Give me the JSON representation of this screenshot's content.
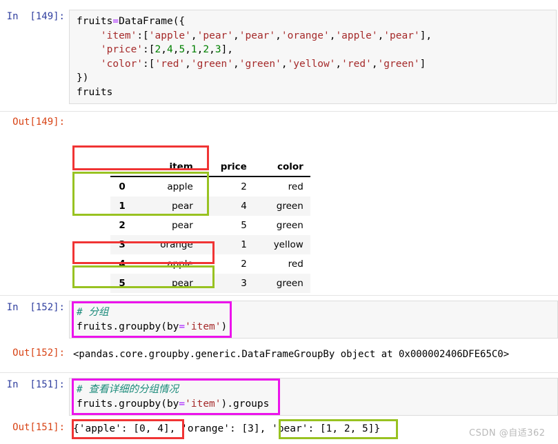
{
  "notebook": {
    "cells": [
      {
        "type": "code",
        "prompt": "In  [149]:",
        "lines": [
          "fruits=DataFrame({",
          "    'item':['apple','pear','pear','orange','apple','pear'],",
          "    'price':[2,4,5,1,2,3],",
          "    'color':['red','green','green','yellow','red','green']",
          "})",
          "fruits"
        ]
      },
      {
        "type": "output",
        "prompt": "Out[149]:",
        "kind": "dataframe"
      },
      {
        "type": "code",
        "prompt": "In  [152]:",
        "lines": [
          "# 分组",
          "fruits.groupby(by='item')"
        ]
      },
      {
        "type": "output",
        "prompt": "Out[152]:",
        "kind": "text",
        "text": "<pandas.core.groupby.generic.DataFrameGroupBy object at 0x000002406DFE65C0>"
      },
      {
        "type": "code",
        "prompt": "In  [151]:",
        "lines": [
          "# 查看详细的分组情况",
          "fruits.groupby(by='item').groups"
        ]
      },
      {
        "type": "output",
        "prompt": "Out[151]:",
        "kind": "groups"
      }
    ]
  },
  "in_149": {
    "prompt": "In  [149]:",
    "line1_a": "fruits",
    "line1_op": "=",
    "line1_b": "DataFrame({",
    "line2_indent": "    ",
    "line2_key": "'item'",
    "line2_colon": ":[",
    "line2_v1": "'apple'",
    "line2_c1": ",",
    "line2_v2": "'pear'",
    "line2_c2": ",",
    "line2_v3": "'pear'",
    "line2_c3": ",",
    "line2_v4": "'orange'",
    "line2_c4": ",",
    "line2_v5": "'apple'",
    "line2_c5": ",",
    "line2_v6": "'pear'",
    "line2_end": "],",
    "line3_indent": "    ",
    "line3_key": "'price'",
    "line3_colon": ":[",
    "line3_n1": "2",
    "line3_n2": "4",
    "line3_n3": "5",
    "line3_n4": "1",
    "line3_n5": "2",
    "line3_n6": "3",
    "line3_end": "],",
    "line4_indent": "    ",
    "line4_key": "'color'",
    "line4_colon": ":[",
    "line4_v1": "'red'",
    "line4_v2": "'green'",
    "line4_v3": "'green'",
    "line4_v4": "'yellow'",
    "line4_v5": "'red'",
    "line4_v6": "'green'",
    "line4_end": "]",
    "line5": "})",
    "line6": "fruits",
    "comma": ","
  },
  "out_149": {
    "prompt": "Out[149]:",
    "columns": [
      "item",
      "price",
      "color"
    ],
    "index_header": "",
    "rows": [
      {
        "index": "0",
        "item": "apple",
        "price": "2",
        "color": "red"
      },
      {
        "index": "1",
        "item": "pear",
        "price": "4",
        "color": "green"
      },
      {
        "index": "2",
        "item": "pear",
        "price": "5",
        "color": "green"
      },
      {
        "index": "3",
        "item": "orange",
        "price": "1",
        "color": "yellow"
      },
      {
        "index": "4",
        "item": "apple",
        "price": "2",
        "color": "red"
      },
      {
        "index": "5",
        "item": "pear",
        "price": "3",
        "color": "green"
      }
    ]
  },
  "in_152": {
    "prompt": "In  [152]:",
    "comment": "# 分组",
    "code_a": "fruits.groupby(by",
    "code_op": "=",
    "code_str": "'item'",
    "code_b": ")"
  },
  "out_152": {
    "prompt": "Out[152]:",
    "text": "<pandas.core.groupby.generic.DataFrameGroupBy object at 0x000002406DFE65C0>"
  },
  "in_151": {
    "prompt": "In  [151]:",
    "comment": "# 查看详细的分组情况",
    "code_a": "fruits.groupby(by",
    "code_op": "=",
    "code_str": "'item'",
    "code_b": ").groups"
  },
  "out_151": {
    "prompt": "Out[151]:",
    "seg_apple": "{'apple': [0, 4],",
    "seg_orange": " 'orange': [3], ",
    "seg_pear": "'pear': [1, 2, 5]}"
  },
  "annotations": {
    "colors": {
      "red": "#f03434",
      "green": "#98c221",
      "magenta": "#ec13ec"
    },
    "boxes": [
      {
        "name": "highlight-row-0",
        "color": "red"
      },
      {
        "name": "highlight-rows-1-2",
        "color": "green"
      },
      {
        "name": "highlight-row-4",
        "color": "red"
      },
      {
        "name": "highlight-row-5",
        "color": "green"
      },
      {
        "name": "highlight-code-152",
        "color": "magenta"
      },
      {
        "name": "highlight-code-151",
        "color": "magenta"
      },
      {
        "name": "highlight-apple-group",
        "color": "red"
      },
      {
        "name": "highlight-pear-group",
        "color": "green"
      }
    ]
  },
  "watermark": {
    "text": "CSDN @自适362"
  }
}
